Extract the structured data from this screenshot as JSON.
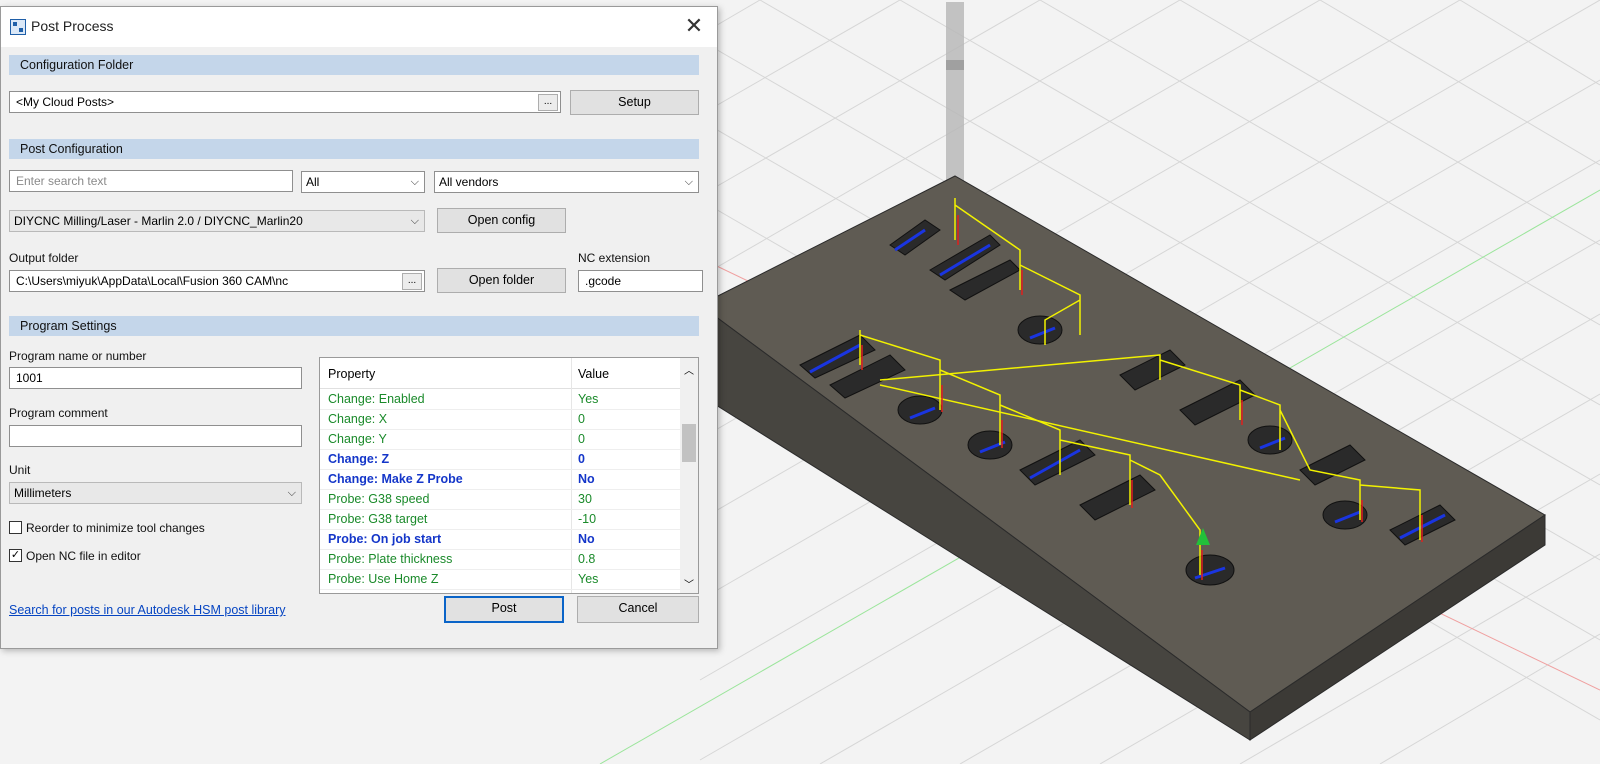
{
  "dialog": {
    "title": "Post Process",
    "close_glyph": "✕",
    "config_folder": {
      "header": "Configuration Folder",
      "path": "<My Cloud Posts>",
      "browse": "...",
      "setup": "Setup"
    },
    "post_config": {
      "header": "Post Configuration",
      "search_placeholder": "Enter search text",
      "filter_value": "All",
      "vendor_value": "All vendors",
      "post_value": "DIYCNC Milling/Laser - Marlin 2.0 / DIYCNC_Marlin20",
      "open_config": "Open config"
    },
    "output": {
      "folder_label": "Output folder",
      "folder_path": "C:\\Users\\miyuk\\AppData\\Local\\Fusion 360 CAM\\nc",
      "browse": "...",
      "open_folder": "Open folder",
      "ext_label": "NC extension",
      "ext_value": ".gcode"
    },
    "program": {
      "header": "Program Settings",
      "name_label": "Program name or number",
      "name_value": "1001",
      "comment_label": "Program comment",
      "comment_value": "",
      "unit_label": "Unit",
      "unit_value": "Millimeters",
      "reorder_label": "Reorder to minimize tool changes",
      "reorder_checked": false,
      "open_nc_label": "Open NC file in editor",
      "open_nc_checked": true,
      "check_glyph": "✓"
    },
    "properties": {
      "col_property": "Property",
      "col_value": "Value",
      "rows": [
        {
          "name": "Change: Enabled",
          "value": "Yes",
          "modified": false
        },
        {
          "name": "Change: X",
          "value": "0",
          "modified": false
        },
        {
          "name": "Change: Y",
          "value": "0",
          "modified": false
        },
        {
          "name": "Change: Z",
          "value": "0",
          "modified": true
        },
        {
          "name": "Change: Make Z Probe",
          "value": "No",
          "modified": true
        },
        {
          "name": "Probe: G38 speed",
          "value": "30",
          "modified": false
        },
        {
          "name": "Probe: G38 target",
          "value": "-10",
          "modified": false
        },
        {
          "name": "Probe: On job start",
          "value": "No",
          "modified": true
        },
        {
          "name": "Probe: Plate thickness",
          "value": "0.8",
          "modified": false
        },
        {
          "name": "Probe: Use Home Z",
          "value": "Yes",
          "modified": false
        }
      ],
      "scroll_up": "︿",
      "scroll_down": "﹀"
    },
    "footer": {
      "library_link": "Search for posts in our Autodesk HSM post library",
      "post": "Post",
      "cancel": "Cancel"
    }
  },
  "colors": {
    "header_band": "#c4d6ea",
    "default_property": "#1a8a2a",
    "modified_property": "#1436c9",
    "toolpath": "#f2f200",
    "stock": "#5e5a52"
  }
}
